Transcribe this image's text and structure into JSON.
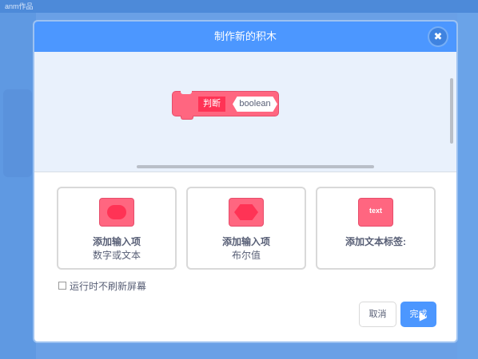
{
  "backdrop": {
    "topbar_text": "anm作品"
  },
  "modal": {
    "title": "制作新的积木",
    "close_icon_glyph": "✖",
    "preview": {
      "block_label": "判断",
      "block_argument": "boolean",
      "block_color": "#ff6680"
    },
    "options": [
      {
        "title": "添加输入项",
        "subtitle": "数字或文本",
        "icon": "round-input-icon"
      },
      {
        "title": "添加输入项",
        "subtitle": "布尔值",
        "icon": "boolean-input-icon"
      },
      {
        "title": "添加文本标签:",
        "subtitle": "",
        "icon": "text-label-icon",
        "icon_text": "text"
      }
    ],
    "checkbox": {
      "label": "运行时不刷新屏幕",
      "checked": false
    },
    "buttons": {
      "cancel": "取消",
      "ok": "完成"
    },
    "accent_color": "#4c97ff"
  }
}
